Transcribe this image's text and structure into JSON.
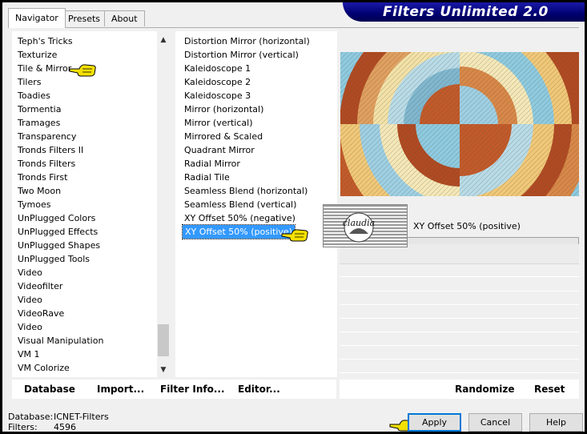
{
  "tabs": [
    {
      "label": "Navigator",
      "active": true
    },
    {
      "label": "Presets",
      "active": false
    },
    {
      "label": "About",
      "active": false
    }
  ],
  "banner": {
    "title": "Filters Unlimited 2.0"
  },
  "categories": [
    "Teph's Tricks",
    "Texturize",
    "Tile & Mirror",
    "Tilers",
    "Toadies",
    "Tormentia",
    "Tramages",
    "Transparency",
    "Tronds Filters II",
    "Tronds Filters",
    "Tronds First",
    "Two Moon",
    "Tymoes",
    "UnPlugged Colors",
    "UnPlugged Effects",
    "UnPlugged Shapes",
    "UnPlugged Tools",
    "Video",
    "Videofilter",
    "Video",
    "VideoRave",
    "Video",
    "Visual Manipulation",
    "VM 1",
    "VM Colorize"
  ],
  "selected_category_index": 2,
  "filters": [
    "Distortion Mirror (horizontal)",
    "Distortion Mirror (vertical)",
    "Kaleidoscope 1",
    "Kaleidoscope 2",
    "Kaleidoscope 3",
    "Mirror (horizontal)",
    "Mirror (vertical)",
    "Mirrored & Scaled",
    "Quadrant Mirror",
    "Radial Mirror",
    "Radial Tile",
    "Seamless Blend (horizontal)",
    "Seamless Blend (vertical)",
    "XY Offset 50% (negative)",
    "XY Offset 50% (positive)"
  ],
  "selected_filter_index": 14,
  "selected_filter_name": "XY Offset 50% (positive)",
  "watermark_text": "claudia",
  "toolbar_left": {
    "database": "Database",
    "import": "Import...",
    "filter_info": "Filter Info...",
    "editor": "Editor..."
  },
  "toolbar_right": {
    "randomize": "Randomize",
    "reset": "Reset"
  },
  "status": {
    "database_label": "Database:",
    "database_value": "ICNET-Filters",
    "filters_label": "Filters:",
    "filters_value": "4596"
  },
  "buttons": {
    "apply": "Apply",
    "cancel": "Cancel",
    "help": "Help"
  },
  "colors": {
    "selection": "#3399ff",
    "banner": "#000070",
    "pointer": "#f5e000"
  }
}
